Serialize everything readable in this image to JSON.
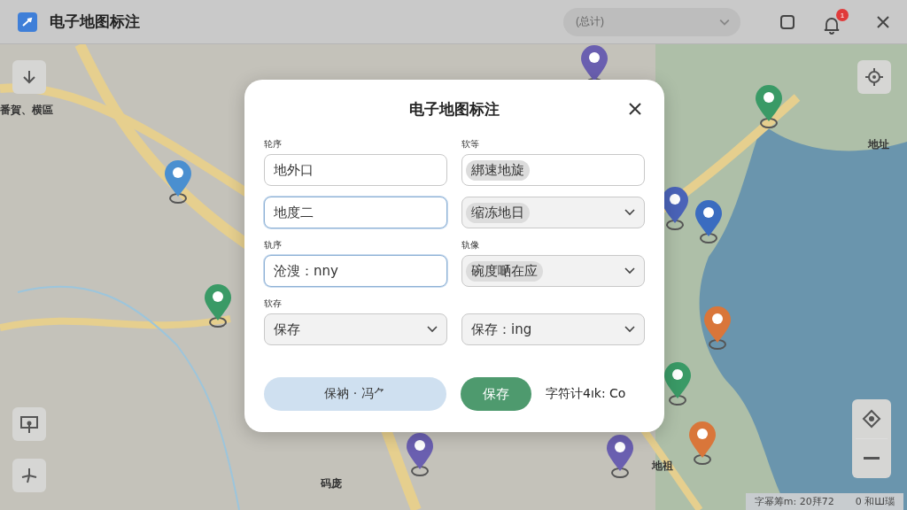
{
  "window": {
    "title": "电子地图标注",
    "filter": {
      "value": "(总计)"
    },
    "notifications": {
      "badge": "1"
    }
  },
  "map": {
    "labels": [
      {
        "text": "番賀、横區"
      },
      {
        "text": "码庞"
      },
      {
        "text": "地祖"
      },
      {
        "text": "地址"
      }
    ],
    "pins": [
      {
        "color": "#4a8fd0"
      },
      {
        "color": "#3a9a66"
      },
      {
        "color": "#6a5fb0"
      },
      {
        "color": "#3a9a66"
      },
      {
        "color": "#4a63b8"
      },
      {
        "color": "#3a6cc0"
      },
      {
        "color": "#d9763a"
      },
      {
        "color": "#3a9a66"
      },
      {
        "color": "#d9763a"
      },
      {
        "color": "#6a5fb0"
      },
      {
        "color": "#6a5fb0"
      }
    ],
    "attribution": [
      "字幂筹m: 20拜72",
      "0 和Ш瑙"
    ]
  },
  "dialog": {
    "title": "电子地图标注",
    "rows": [
      [
        {
          "kind": "text",
          "label": "轮序",
          "value": "地外口",
          "chip": false,
          "focused": false
        },
        {
          "kind": "text",
          "label": "软等",
          "value": "綁速地旋",
          "chip": true,
          "focused": false
        }
      ],
      [
        {
          "kind": "text",
          "value": "地度二",
          "chip": false,
          "focused": true
        },
        {
          "kind": "select",
          "value": "缩冻地日",
          "chip": true,
          "focused": false
        }
      ],
      [
        {
          "kind": "text",
          "label": "轨序",
          "value": "沧溲：nny",
          "chip": false,
          "focused": true
        },
        {
          "kind": "select",
          "label": "轨像",
          "value": "碗度嗮在应",
          "chip": true,
          "focused": false
        }
      ],
      [
        {
          "kind": "select",
          "label": "软存",
          "value": "保存",
          "chip": false,
          "focused": false
        },
        {
          "kind": "select",
          "value": "保存：ing",
          "chip": false,
          "focused": false
        }
      ]
    ],
    "secondary_button": "保衲 · 冯⺈",
    "primary_button": "保存",
    "counter": "字符计4ık: Co"
  }
}
